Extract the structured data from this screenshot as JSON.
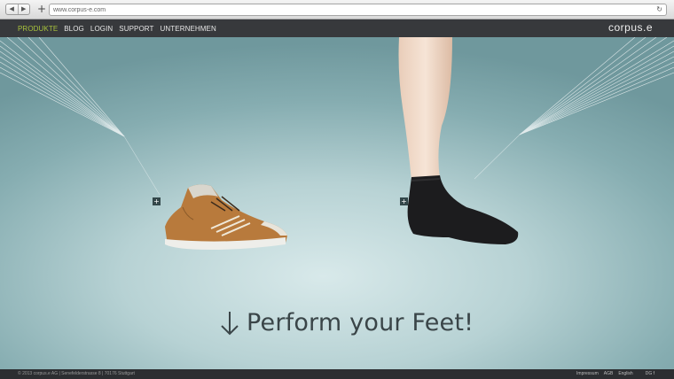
{
  "browser": {
    "back_glyph": "◀",
    "forward_glyph": "▶",
    "new_tab_glyph": "+",
    "url": "www.corpus-e.com",
    "reload_glyph": "↻"
  },
  "nav": {
    "items": [
      "PRODUKTE",
      "BLOG",
      "LOGIN",
      "SUPPORT",
      "UNTERNEHMEN"
    ],
    "active_item": "PRODUKTE",
    "brand": "corpus.e"
  },
  "hero": {
    "marker_glyph": "+",
    "headline": "Perform your Feet!"
  },
  "footer": {
    "copyright": "© 2013 corpus.e AG | Senefelderstrasse 8 | 70176 Stuttgart",
    "links": [
      "Impressum",
      "AGB",
      "English"
    ],
    "social": "DG  f"
  },
  "colors": {
    "nav_bg": "#37393c",
    "nav_active": "#a8c23c",
    "hero_center": "#d8e9ea",
    "hero_edge": "#6f989d",
    "footer_bg": "#2c2e31"
  }
}
